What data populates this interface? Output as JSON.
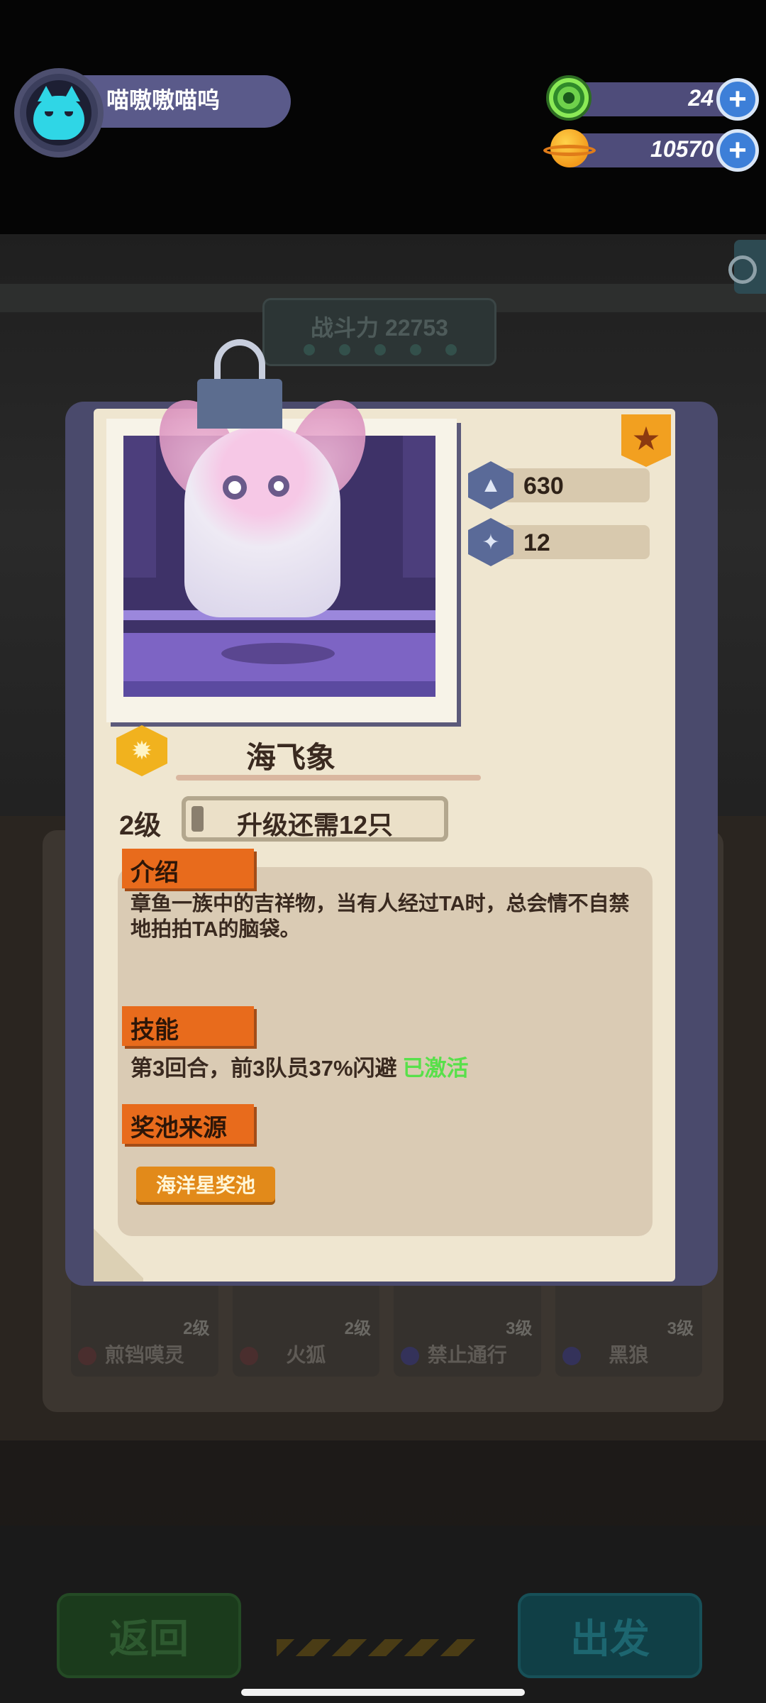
{
  "hud": {
    "player_name": "喵嗷嗷喵呜",
    "currencies": [
      {
        "icon": "green-gem-coin-icon",
        "value": "24"
      },
      {
        "icon": "planet-coin-icon",
        "value": "10570"
      }
    ],
    "plus_glyph": "+"
  },
  "background": {
    "power_label": "战斗力 22753",
    "cards": [
      {
        "name": "煎铛嗼灵",
        "level": "2级"
      },
      {
        "name": "火狐",
        "level": "2级"
      },
      {
        "name": "禁止通行",
        "level": "3级"
      },
      {
        "name": "黑狼",
        "level": "3级"
      }
    ],
    "back_label": "返回",
    "go_label": "出发"
  },
  "card": {
    "stats": [
      {
        "icon": "rocket-hex-icon",
        "value": "630"
      },
      {
        "icon": "frog-hex-icon",
        "value": "12"
      }
    ],
    "name": "海飞象",
    "level": "2级",
    "upgrade_text": "升级还需12只",
    "upgrade_progress": 0.05,
    "intro_title": "介绍",
    "intro_text": "章鱼一族中的吉祥物，当有人经过TA时，总会情不自禁地拍拍TA的脑袋。",
    "skill_title": "技能",
    "skill_text": "第3回合，前3队员37%闪避",
    "skill_status": "已激活",
    "source_title": "奖池来源",
    "source_button": "海洋星奖池"
  },
  "colors": {
    "accent_orange": "#e86b1c",
    "active_green": "#58e04a",
    "paper": "#efe6d0"
  }
}
